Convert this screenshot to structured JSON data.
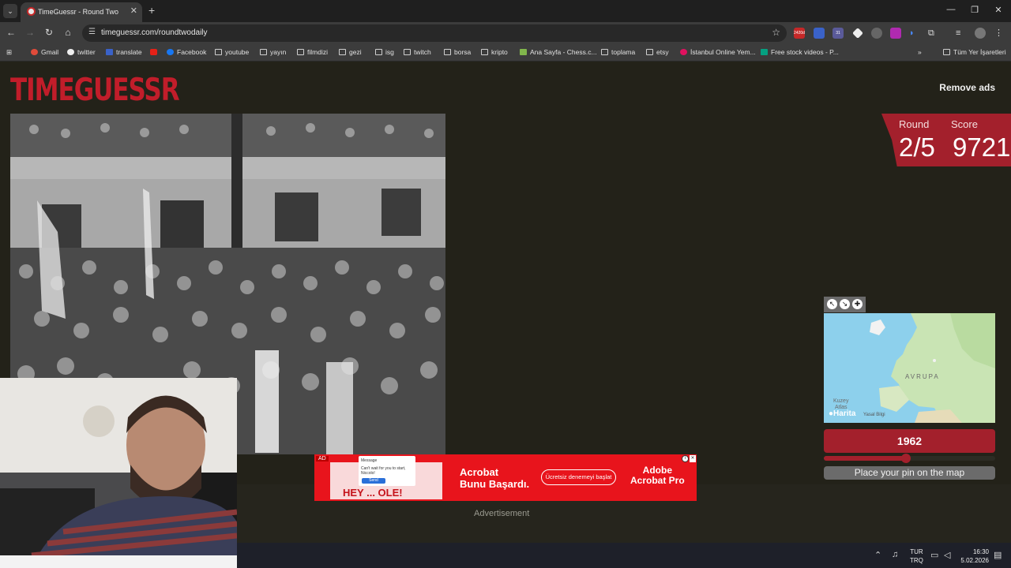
{
  "browser": {
    "tab_title": "TimeGuessr - Round Two",
    "url": "timeguessr.com/roundtwodaily",
    "bookmarks": [
      "Gmail",
      "twitter",
      "translate",
      "Facebook",
      "youtube",
      "yayın",
      "filmdizi",
      "gezi",
      "isg",
      "twitch",
      "borsa",
      "kripto",
      "Ana Sayfa - Chess.c...",
      "toplama",
      "etsy",
      "İstanbul Online Yem...",
      "Free stock videos - P...",
      "Tüm Yer İşaretleri"
    ],
    "extension_badges": [
      "2420d",
      "31"
    ]
  },
  "game": {
    "logo": "TIMEGUESSR",
    "remove_ads": "Remove ads",
    "round_label": "Round",
    "round_value": "2/5",
    "score_label": "Score",
    "score_value": "9721",
    "year": "1962",
    "slider_fraction": 0.48,
    "place_pin": "Place your pin on the map",
    "map": {
      "region_label": "AVRUPA",
      "sea_label_1": "Kuzey",
      "sea_label_2": "Atlas",
      "attribution": "Harita",
      "legal": "Yasal Bilgi"
    }
  },
  "advertisement": {
    "ad_tag": "AD",
    "chat_title": "Message",
    "chat_text": "Can't wait for you to start, Niccolo!",
    "chat_send": "Send",
    "thumb_text": "HEY ... OLE!",
    "headline_1": "Acrobat",
    "headline_2": "Bunu Başardı.",
    "cta": "Ücretsiz denemeyi başlat",
    "brand_1": "Adobe",
    "brand_2": "Acrobat Pro",
    "label": "Advertisement"
  },
  "taskbar": {
    "lang_1": "TUR",
    "lang_2": "TRQ",
    "time": "16:30",
    "date": "5.02.2026"
  }
}
